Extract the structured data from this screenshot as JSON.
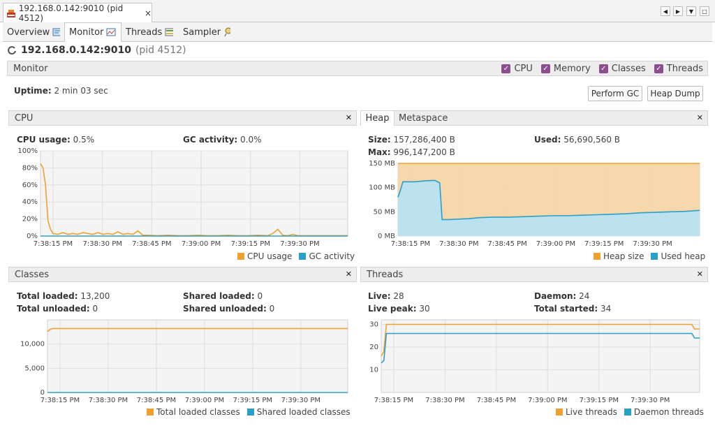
{
  "doc_tab": {
    "title": "192.168.0.142:9010 (pid 4512)",
    "close": "×"
  },
  "window_controls": [
    "◀",
    "▶",
    "▼",
    "□"
  ],
  "sub_tabs": [
    {
      "label": "Overview",
      "icon": "overview-icon"
    },
    {
      "label": "Monitor",
      "icon": "monitor-icon",
      "active": true
    },
    {
      "label": "Threads",
      "icon": "threads-icon"
    },
    {
      "label": "Sampler",
      "icon": "sampler-icon"
    }
  ],
  "header": {
    "host": "192.168.0.142:9010",
    "pid": "(pid 4512)"
  },
  "monitor": {
    "label": "Monitor",
    "checkboxes": [
      "CPU",
      "Memory",
      "Classes",
      "Threads"
    ],
    "uptime_label": "Uptime:",
    "uptime_value": "2 min 03 sec",
    "perform_gc": "Perform GC",
    "heap_dump": "Heap Dump"
  },
  "cpu": {
    "title": "CPU",
    "usage_label": "CPU usage:",
    "usage_value": "0.5%",
    "gc_label": "GC activity:",
    "gc_value": "0.0%",
    "legend": [
      "CPU usage",
      "GC activity"
    ]
  },
  "heap": {
    "tabs": [
      "Heap",
      "Metaspace"
    ],
    "size_label": "Size:",
    "size_value": "157,286,400 B",
    "max_label": "Max:",
    "max_value": "996,147,200 B",
    "used_label": "Used:",
    "used_value": "56,690,560 B",
    "legend": [
      "Heap size",
      "Used heap"
    ]
  },
  "classes": {
    "title": "Classes",
    "total_loaded_label": "Total loaded:",
    "total_loaded_value": "13,200",
    "total_unloaded_label": "Total unloaded:",
    "total_unloaded_value": "0",
    "shared_loaded_label": "Shared loaded:",
    "shared_loaded_value": "0",
    "shared_unloaded_label": "Shared unloaded:",
    "shared_unloaded_value": "0",
    "legend": [
      "Total loaded classes",
      "Shared loaded classes"
    ]
  },
  "threads": {
    "title": "Threads",
    "live_label": "Live:",
    "live_value": "28",
    "live_peak_label": "Live peak:",
    "live_peak_value": "30",
    "daemon_label": "Daemon:",
    "daemon_value": "24",
    "total_started_label": "Total started:",
    "total_started_value": "34",
    "legend": [
      "Live threads",
      "Daemon threads"
    ]
  },
  "colors": {
    "orange": "#f0a030",
    "blue": "#2aa0c8",
    "checkbox": "#8a4f8c"
  },
  "chart_data": [
    {
      "type": "line",
      "id": "cpu",
      "x_ticks": [
        "7:38:15 PM",
        "7:38:30 PM",
        "7:38:45 PM",
        "7:39:00 PM",
        "7:39:15 PM",
        "7:39:30 PM"
      ],
      "y_ticks": [
        "100%",
        "80%",
        "60%",
        "40%",
        "20%",
        "0%"
      ],
      "ylim": [
        0,
        100
      ],
      "xlim": [
        9,
        132
      ],
      "series": [
        {
          "name": "CPU usage",
          "color": "#f0a030",
          "x": [
            9,
            10,
            11,
            12,
            13,
            14,
            16,
            18,
            20,
            22,
            24,
            26,
            28,
            30,
            32,
            34,
            36,
            38,
            40,
            42,
            44,
            46,
            48,
            50,
            52,
            56,
            60,
            64,
            68,
            72,
            76,
            80,
            84,
            88,
            92,
            96,
            100,
            102,
            104,
            106,
            108,
            110,
            112,
            116,
            120,
            124,
            128,
            132
          ],
          "y": [
            85,
            80,
            60,
            18,
            8,
            3,
            2,
            4,
            2,
            3,
            2,
            4,
            3,
            2,
            4,
            2,
            3,
            2,
            5,
            2,
            3,
            2,
            6,
            1,
            1,
            0.5,
            1,
            0.5,
            0.5,
            1,
            0.5,
            0.5,
            1,
            0.5,
            0.5,
            1,
            0.5,
            3,
            8,
            1,
            0.5,
            2,
            0.5,
            0.5,
            0.5,
            0.5,
            0.5,
            0.5
          ]
        },
        {
          "name": "GC activity",
          "color": "#2aa0c8",
          "x": [
            9,
            132
          ],
          "y": [
            0,
            0
          ]
        }
      ]
    },
    {
      "type": "area",
      "id": "heap",
      "x_ticks": [
        "7:38:15 PM",
        "7:38:30 PM",
        "7:38:45 PM",
        "7:39:00 PM",
        "7:39:15 PM",
        "7:39:30 PM"
      ],
      "y_ticks": [
        "150 MB",
        "100 MB",
        "50 MB",
        "0 MB"
      ],
      "ylim": [
        0,
        150
      ],
      "xlim": [
        9,
        132
      ],
      "series": [
        {
          "name": "Heap size",
          "color": "#f0a030",
          "x": [
            9,
            132
          ],
          "y": [
            150,
            150
          ]
        },
        {
          "name": "Used heap",
          "color": "#2aa0c8",
          "x": [
            9,
            10,
            11,
            12,
            13,
            16,
            20,
            24,
            26,
            27,
            28,
            30,
            34,
            38,
            42,
            48,
            54,
            60,
            66,
            72,
            78,
            84,
            90,
            96,
            102,
            108,
            114,
            120,
            126,
            132
          ],
          "y": [
            80,
            95,
            112,
            112,
            112,
            112,
            114,
            115,
            110,
            34,
            34,
            34,
            35,
            36,
            38,
            39,
            39,
            40,
            41,
            42,
            42,
            43,
            44,
            45,
            46,
            48,
            49,
            50,
            51,
            53
          ]
        }
      ]
    },
    {
      "type": "line",
      "id": "classes",
      "x_ticks": [
        "7:38:15 PM",
        "7:38:30 PM",
        "7:38:45 PM",
        "7:39:00 PM",
        "7:39:15 PM",
        "7:39:30 PM"
      ],
      "y_ticks": [
        "10,000",
        "5,000",
        "0"
      ],
      "ylim": [
        0,
        15000
      ],
      "xlim": [
        9,
        132
      ],
      "series": [
        {
          "name": "Total loaded classes",
          "color": "#f0a030",
          "x": [
            9,
            10,
            11,
            132
          ],
          "y": [
            12600,
            13000,
            13200,
            13200
          ]
        },
        {
          "name": "Shared loaded classes",
          "color": "#2aa0c8",
          "x": [
            9,
            132
          ],
          "y": [
            0,
            0
          ]
        }
      ]
    },
    {
      "type": "line",
      "id": "threads",
      "x_ticks": [
        "7:38:15 PM",
        "7:38:30 PM",
        "7:38:45 PM",
        "7:39:00 PM",
        "7:39:15 PM",
        "7:39:30 PM"
      ],
      "y_ticks": [
        "30",
        "20",
        "10"
      ],
      "ylim": [
        0,
        32
      ],
      "xlim": [
        9,
        132
      ],
      "series": [
        {
          "name": "Live threads",
          "color": "#f0a030",
          "x": [
            9,
            10,
            11,
            12,
            129,
            130,
            132
          ],
          "y": [
            16,
            18,
            30,
            30,
            30,
            28,
            28
          ]
        },
        {
          "name": "Daemon threads",
          "color": "#2aa0c8",
          "x": [
            9,
            10,
            11,
            12,
            129,
            130,
            132
          ],
          "y": [
            13,
            14,
            26,
            26,
            26,
            24,
            24
          ]
        }
      ]
    }
  ]
}
